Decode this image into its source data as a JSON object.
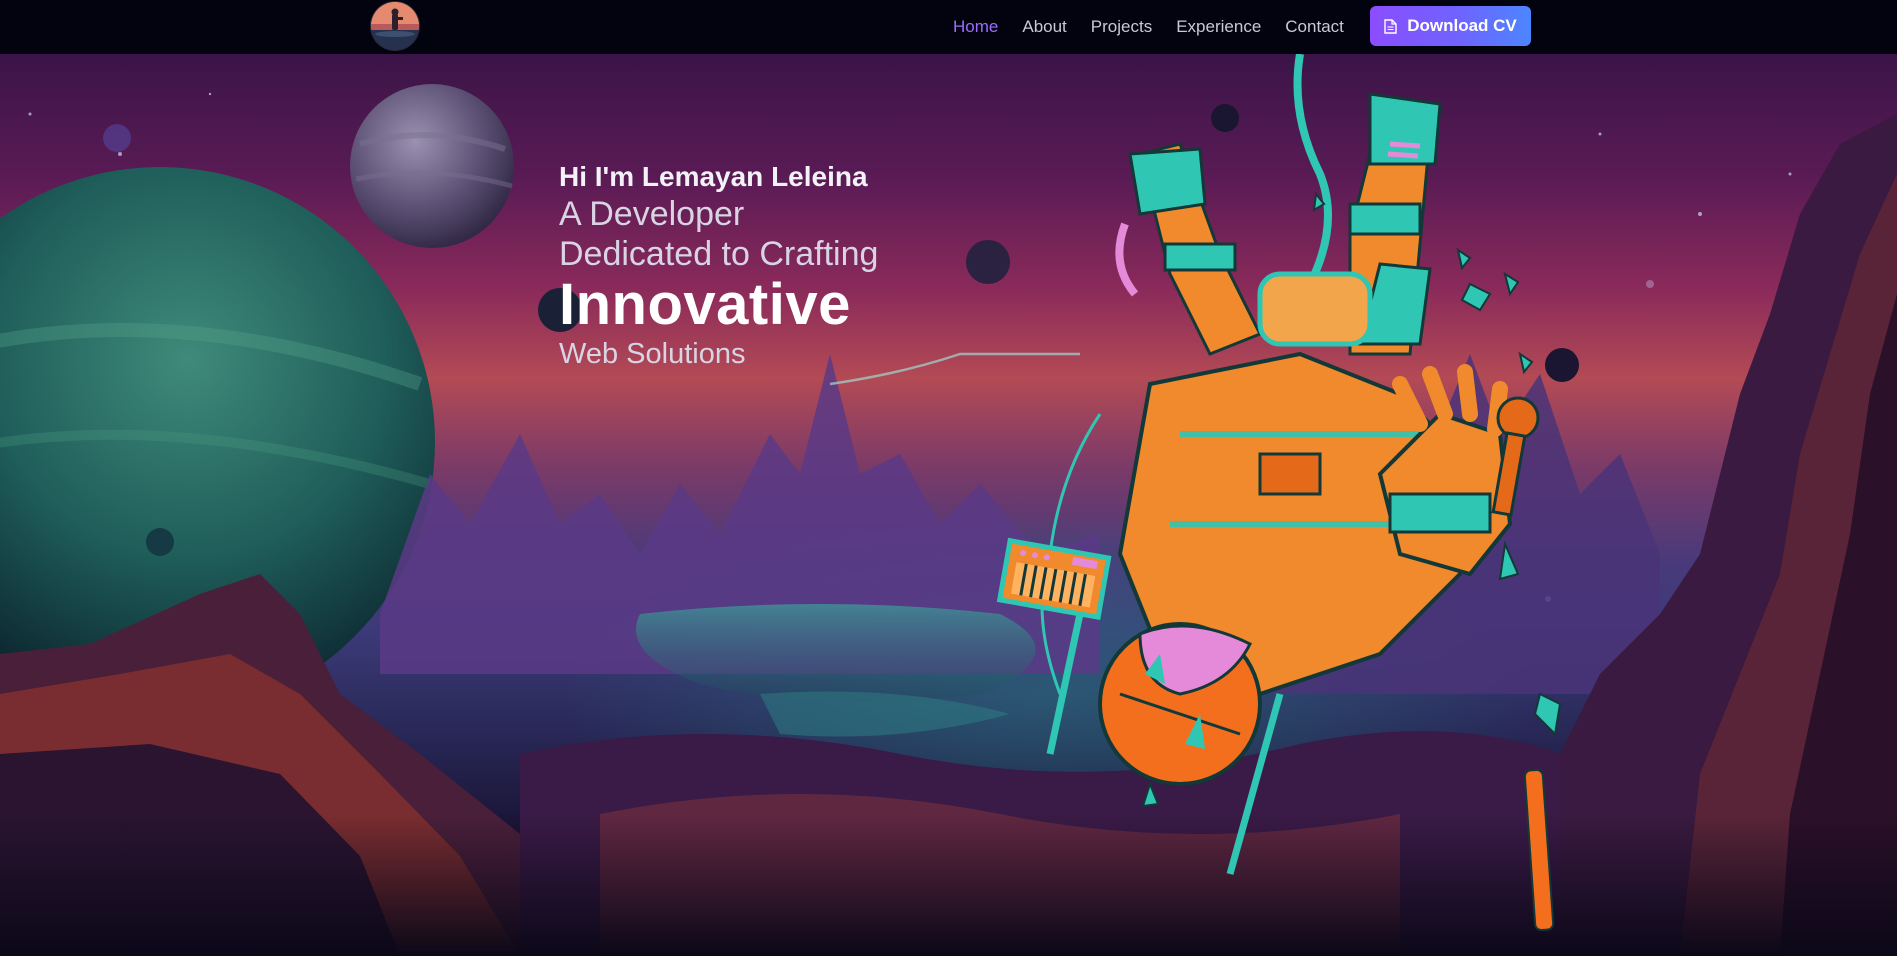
{
  "nav": {
    "links": [
      {
        "label": "Home",
        "active": true
      },
      {
        "label": "About",
        "active": false
      },
      {
        "label": "Projects",
        "active": false
      },
      {
        "label": "Experience",
        "active": false
      },
      {
        "label": "Contact",
        "active": false
      }
    ],
    "cv_button": {
      "label": "Download CV",
      "icon": "document-icon"
    },
    "logo": {
      "icon": "avatar-logo"
    }
  },
  "hero": {
    "greeting": "Hi I'm Lemayan Leleina",
    "line1": "A Developer",
    "line2": "Dedicated to Crafting",
    "headline": "Innovative",
    "line3": "Web Solutions",
    "illustration": "astronaut-space-landscape"
  },
  "colors": {
    "nav_bg": "#03030f",
    "active_link": "#9b6cff",
    "cv_gradient_start": "#8b4dff",
    "cv_gradient_end": "#4c86ff",
    "astronaut_orange": "#f08a2c",
    "astronaut_teal": "#2fc6b4"
  }
}
